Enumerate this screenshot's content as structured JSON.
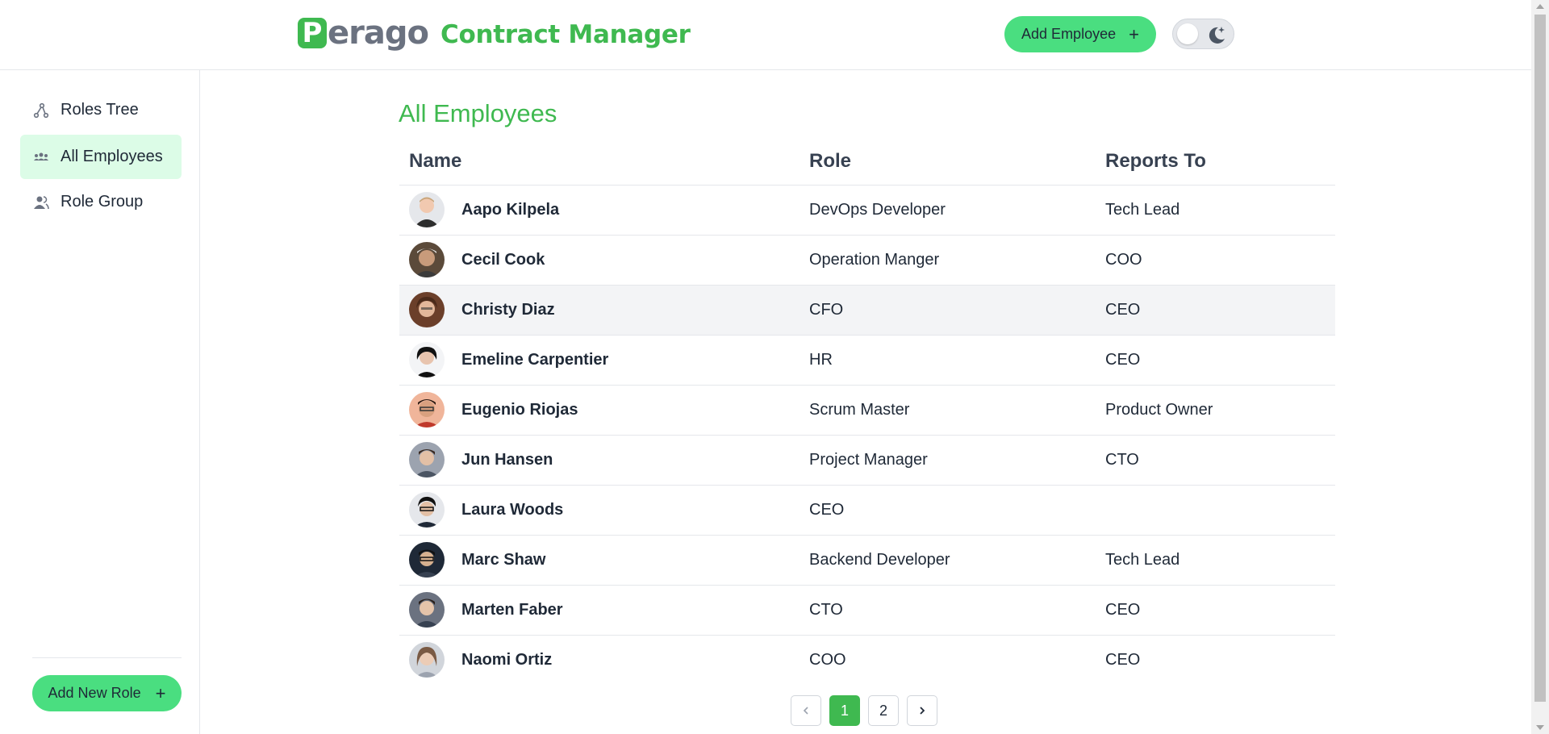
{
  "header": {
    "logo_letter": "P",
    "logo_rest": "erago",
    "app_title": "Contract Manager",
    "add_employee_label": "Add Employee",
    "add_icon": "plus-icon",
    "theme_toggle_icon": "moon-icon",
    "brand_color": "#3fb950",
    "button_color": "#4ade80"
  },
  "sidebar": {
    "items": [
      {
        "label": "Roles Tree",
        "icon": "roles-tree-icon",
        "active": false
      },
      {
        "label": "All Employees",
        "icon": "users-group-icon",
        "active": true
      },
      {
        "label": "Role Group",
        "icon": "role-group-icon",
        "active": false
      }
    ],
    "add_role_label": "Add New Role"
  },
  "main": {
    "title": "All Employees",
    "columns": [
      "Name",
      "Role",
      "Reports To"
    ],
    "rows": [
      {
        "name": "Aapo Kilpela",
        "role": "DevOps Developer",
        "reports_to": "Tech Lead"
      },
      {
        "name": "Cecil Cook",
        "role": "Operation Manger",
        "reports_to": "COO"
      },
      {
        "name": "Christy Diaz",
        "role": "CFO",
        "reports_to": "CEO"
      },
      {
        "name": "Emeline Carpentier",
        "role": "HR",
        "reports_to": "CEO"
      },
      {
        "name": "Eugenio Riojas",
        "role": "Scrum Master",
        "reports_to": "Product Owner"
      },
      {
        "name": "Jun Hansen",
        "role": "Project Manager",
        "reports_to": "CTO"
      },
      {
        "name": "Laura Woods",
        "role": "CEO",
        "reports_to": ""
      },
      {
        "name": "Marc Shaw",
        "role": "Backend Developer",
        "reports_to": "Tech Lead"
      },
      {
        "name": "Marten Faber",
        "role": "CTO",
        "reports_to": "CEO"
      },
      {
        "name": "Naomi Ortiz",
        "role": "COO",
        "reports_to": "CEO"
      }
    ]
  },
  "pagination": {
    "prev_icon": "chevron-left-icon",
    "pages": [
      "1",
      "2"
    ],
    "current_page": "1",
    "next_icon": "chevron-right-icon"
  }
}
